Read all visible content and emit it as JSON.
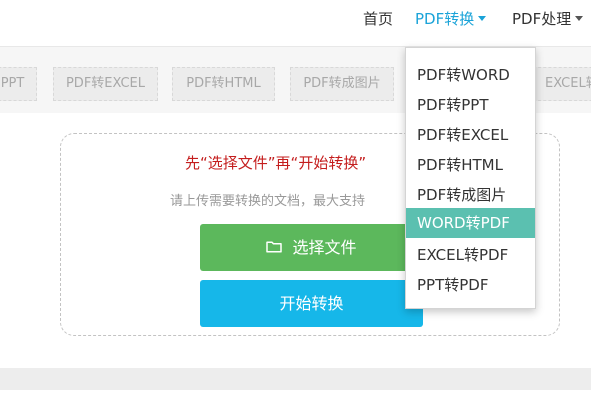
{
  "nav": {
    "home": "首页",
    "pdf_convert": "PDF转换",
    "pdf_process": "PDF处理"
  },
  "tabs": [
    "PPT",
    "PDF转EXCEL",
    "PDF转HTML",
    "PDF转成图片",
    "EXCEL转"
  ],
  "upload": {
    "instruction": "先“选择文件”再“开始转换”",
    "subtext": "请上传需要转换的文档，最大支持",
    "choose_label": "选择文件",
    "start_label": "开始转换"
  },
  "dropdown": {
    "items": [
      "PDF转WORD",
      "PDF转PPT",
      "PDF转EXCEL",
      "PDF转HTML",
      "PDF转成图片",
      "WORD转PDF",
      "EXCEL转PDF",
      "PPT转PDF"
    ],
    "active": "WORD转PDF"
  },
  "colors": {
    "nav_active": "#1aa3d8",
    "choose_button": "#5cb85c",
    "start_button": "#16b7e9",
    "instruction_text": "#c41d1d",
    "dropdown_active": "#5bc0b0"
  }
}
